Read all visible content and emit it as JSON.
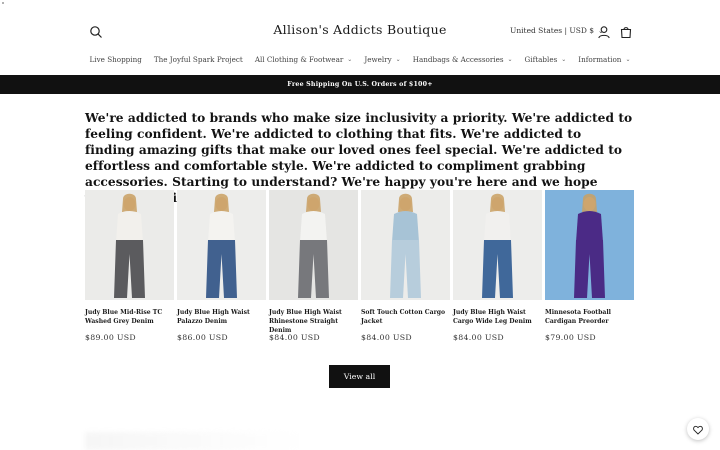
{
  "header": {
    "brand": "Allison's Addicts Boutique",
    "locale": "United States | USD $"
  },
  "nav": {
    "items": [
      {
        "label": "Live Shopping",
        "dropdown": false
      },
      {
        "label": "The Joyful Spark Project",
        "dropdown": false
      },
      {
        "label": "All Clothing & Footwear",
        "dropdown": true
      },
      {
        "label": "Jewelry",
        "dropdown": true
      },
      {
        "label": "Handbags & Accessories",
        "dropdown": true
      },
      {
        "label": "Giftables",
        "dropdown": true
      },
      {
        "label": "Information",
        "dropdown": true
      }
    ]
  },
  "announcement": "Free Shipping On U.S. Orders of $100+",
  "intro": "We're addicted to brands who make size inclusivity a priority. We're addicted to feeling confident. We're addicted to clothing that fits. We're addicted to finding amazing gifts that make our loved ones feel special. We're addicted to effortless and comfortable style. We're addicted to compliment grabbing accessories. Starting to understand? We're happy you're here and we hope you'll be addicted too!",
  "products": [
    {
      "title": "Judy Blue Mid-Rise TC Washed Grey Denim",
      "price": "$89.00 USD",
      "top": "#f2f0ec",
      "bottom": "#5b5b5e",
      "bg": "#ebebe9"
    },
    {
      "title": "Judy Blue High Waist Palazzo Denim",
      "price": "$86.00 USD",
      "top": "#f4f3f0",
      "bottom": "#41618f",
      "bg": "#ededeb"
    },
    {
      "title": "Judy Blue High Waist Rhinestone Straight Denim",
      "price": "$84.00 USD",
      "top": "#f3f3f1",
      "bottom": "#77787c",
      "bg": "#e5e5e3"
    },
    {
      "title": "Soft Touch Cotton Cargo Jacket",
      "price": "$84.00 USD",
      "top": "#a7c3d6",
      "bottom": "#b7cddc",
      "bg": "#ececea"
    },
    {
      "title": "Judy Blue High Waist Cargo Wide Leg Denim",
      "price": "$84.00 USD",
      "top": "#f1f0ee",
      "bottom": "#40689a",
      "bg": "#ededeb"
    },
    {
      "title": "Minnesota Football Cardigan Preorder",
      "price": "$79.00 USD",
      "top": "#4b2a86",
      "bottom": "#4a2b85",
      "bg": "#7fb2dc"
    }
  ],
  "view_all": "View all",
  "colors": {
    "announcement_bg": "#111111",
    "button_bg": "#111111",
    "text": "#121212"
  },
  "icons": {
    "search": "search-icon",
    "account": "account-icon",
    "cart": "cart-icon",
    "chat": "chat-icon"
  }
}
